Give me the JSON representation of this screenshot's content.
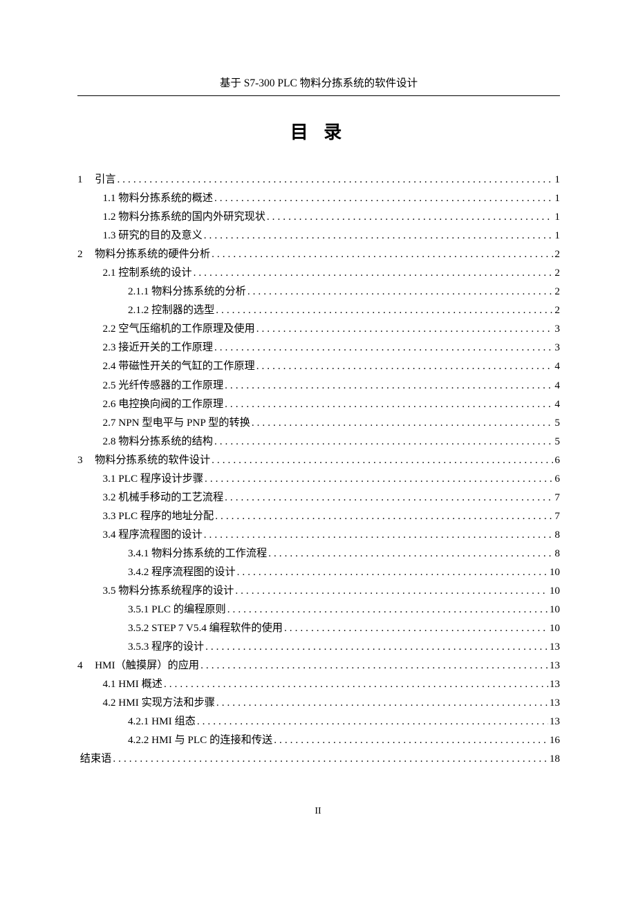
{
  "header_title": "基于 S7-300 PLC 物料分拣系统的软件设计",
  "toc_title": "目  录",
  "footer": "II",
  "entries": [
    {
      "level": 1,
      "num": "1",
      "text": "引言",
      "page": "1"
    },
    {
      "level": 2,
      "num": "1.1",
      "text": "物料分拣系统的概述",
      "page": "1"
    },
    {
      "level": 2,
      "num": "1.2",
      "text": "物料分拣系统的国内外研究现状",
      "page": "1"
    },
    {
      "level": 2,
      "num": "1.3",
      "text": "研究的目的及意义",
      "page": "1"
    },
    {
      "level": 1,
      "num": "2",
      "text": "物料分拣系统的硬件分析",
      "page": "2"
    },
    {
      "level": 2,
      "num": "2.1",
      "text": "控制系统的设计",
      "page": "2"
    },
    {
      "level": 3,
      "num": "2.1.1",
      "text": "物料分拣系统的分析",
      "page": "2"
    },
    {
      "level": 3,
      "num": "2.1.2",
      "text": "控制器的选型",
      "page": "2"
    },
    {
      "level": 2,
      "num": "2.2",
      "text": "空气压缩机的工作原理及使用",
      "page": "3"
    },
    {
      "level": 2,
      "num": "2.3",
      "text": "接近开关的工作原理",
      "page": "3"
    },
    {
      "level": 2,
      "num": "2.4",
      "text": "带磁性开关的气缸的工作原理",
      "page": "4"
    },
    {
      "level": 2,
      "num": "2.5",
      "text": "光纤传感器的工作原理",
      "page": "4"
    },
    {
      "level": 2,
      "num": "2.6",
      "text": "电控换向阀的工作原理",
      "page": "4"
    },
    {
      "level": 2,
      "num": "2.7",
      "text": "NPN 型电平与 PNP 型的转换",
      "page": "5"
    },
    {
      "level": 2,
      "num": "2.8",
      "text": "物料分拣系统的结构",
      "page": "5"
    },
    {
      "level": 1,
      "num": "3",
      "text": "物料分拣系统的软件设计",
      "page": "6"
    },
    {
      "level": 2,
      "num": "3.1",
      "text": "PLC 程序设计步骤",
      "page": "6"
    },
    {
      "level": 2,
      "num": "3.2",
      "text": "机械手移动的工艺流程",
      "page": "7"
    },
    {
      "level": 2,
      "num": "3.3",
      "text": "PLC 程序的地址分配",
      "page": "7"
    },
    {
      "level": 2,
      "num": "3.4",
      "text": "程序流程图的设计",
      "page": "8"
    },
    {
      "level": 3,
      "num": "3.4.1",
      "text": "物料分拣系统的工作流程",
      "page": "8"
    },
    {
      "level": 3,
      "num": "3.4.2",
      "text": "程序流程图的设计",
      "page": "10"
    },
    {
      "level": 2,
      "num": "3.5",
      "text": "物料分拣系统程序的设计",
      "page": "10"
    },
    {
      "level": 3,
      "num": "3.5.1",
      "text": "PLC 的编程原则",
      "page": "10"
    },
    {
      "level": 3,
      "num": "3.5.2",
      "text": "STEP 7 V5.4 编程软件的使用",
      "page": "10"
    },
    {
      "level": 3,
      "num": "3.5.3",
      "text": "程序的设计",
      "page": "13"
    },
    {
      "level": 1,
      "num": "4",
      "text": "HMI（触摸屏）的应用",
      "page": "13"
    },
    {
      "level": 2,
      "num": "4.1",
      "text": "HMI 概述",
      "page": "13"
    },
    {
      "level": 2,
      "num": "4.2",
      "text": "HMI 实现方法和步骤",
      "page": "13"
    },
    {
      "level": 3,
      "num": "4.2.1",
      "text": "HMI 组态",
      "page": "13"
    },
    {
      "level": 3,
      "num": "4.2.2",
      "text": "HMI 与 PLC 的连接和传送",
      "page": "16"
    },
    {
      "level": 1,
      "num": "",
      "text": "结束语",
      "page": "18"
    }
  ]
}
